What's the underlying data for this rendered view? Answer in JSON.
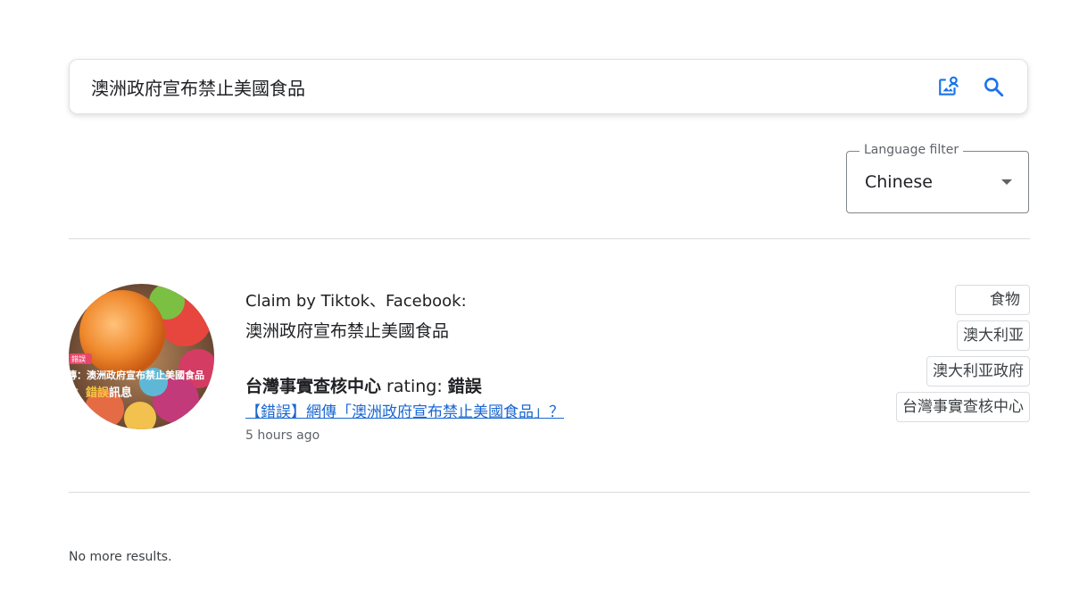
{
  "search": {
    "query": "澳洲政府宣布禁止美國食品"
  },
  "language_filter": {
    "legend": "Language filter",
    "value": "Chinese"
  },
  "result": {
    "claim_title": "Claim by Tiktok、Facebook:",
    "claim_text": "澳洲政府宣布禁止美國食品",
    "rating_source": "台灣事實查核中心",
    "rating_label": " rating: ",
    "rating_value": "錯誤",
    "article_link": "【錯誤】網傳「澳洲政府宣布禁止美國食品」？",
    "timestamp": "5 hours ago",
    "thumbnail": {
      "badge": "錯誤",
      "caption_line1": "傳：澳洲政府宣布禁止美國食品",
      "caption_line2_highlight": "：錯誤",
      "caption_line2_rest": "訊息"
    },
    "tags": [
      "食物",
      "澳大利亚",
      "澳大利亚政府",
      "台灣事實查核中心"
    ]
  },
  "footer": {
    "no_more": "No more results."
  },
  "colors": {
    "accent_blue": "#1a73e8",
    "link": "#1967d2",
    "divider": "#dadce0"
  }
}
